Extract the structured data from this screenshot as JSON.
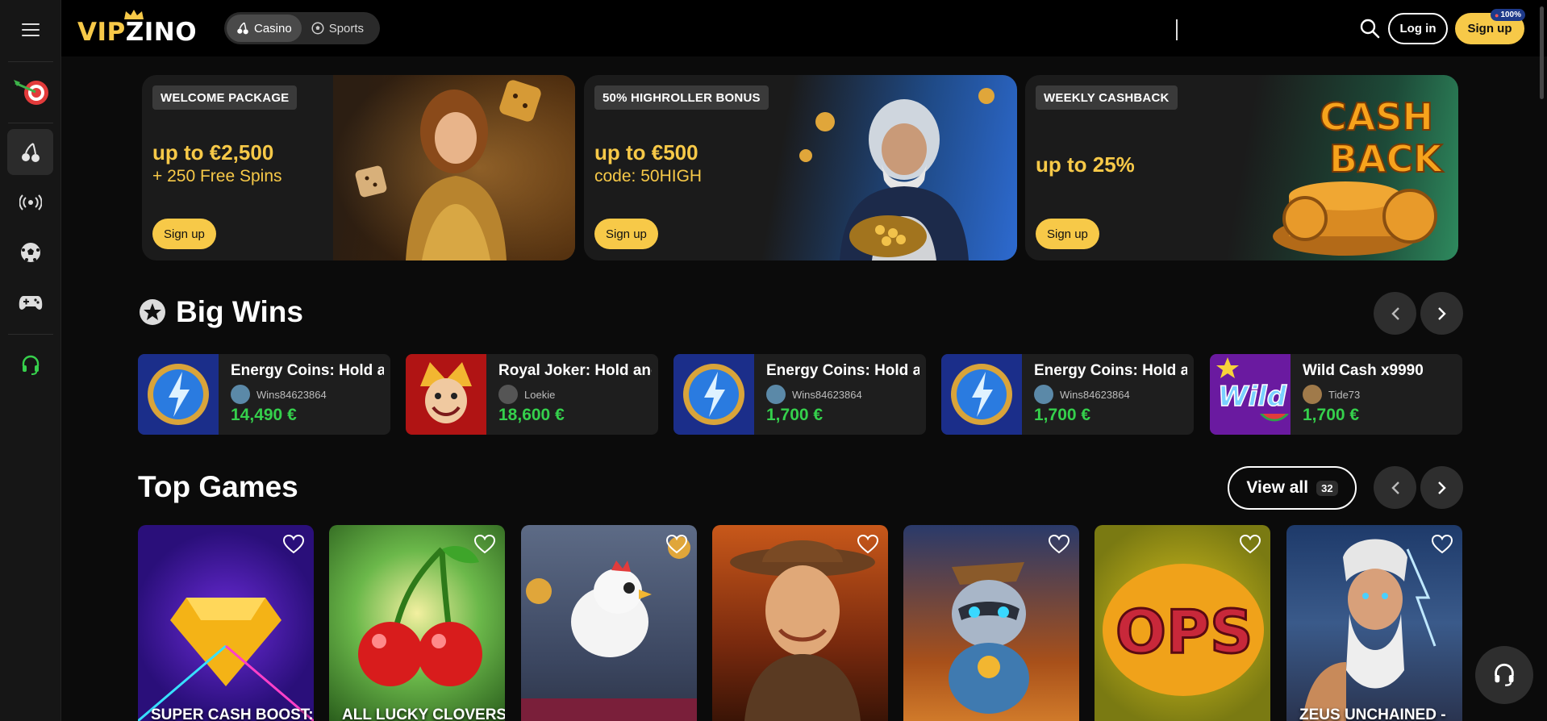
{
  "header": {
    "logo_vip": "VIP",
    "logo_zino": "ZINO",
    "modes": [
      {
        "label": "Casino",
        "active": true
      },
      {
        "label": "Sports",
        "active": false
      }
    ],
    "login_label": "Log in",
    "signup_label": "Sign up",
    "signup_badge": "100%"
  },
  "sidebar": {
    "items": [
      {
        "icon": "menu-icon"
      },
      {
        "icon": "dart-target-icon"
      },
      {
        "icon": "cherries-icon",
        "active": true
      },
      {
        "icon": "live-broadcast-icon"
      },
      {
        "icon": "soccer-ball-icon"
      },
      {
        "icon": "gamepad-icon"
      },
      {
        "icon": "headset-icon"
      }
    ]
  },
  "promos": [
    {
      "tag": "WELCOME PACKAGE",
      "amount": "up to €2,500",
      "sub": "+ 250 Free Spins",
      "cta": "Sign up"
    },
    {
      "tag": "50% HIGHROLLER BONUS",
      "amount": "up to €500",
      "sub": "code: 50HIGH",
      "cta": "Sign up"
    },
    {
      "tag": "WEEKLY CASHBACK",
      "amount": "up to 25%",
      "sub": "",
      "cta": "Sign up",
      "art_text_1": "CASH",
      "art_text_2": "BACK"
    }
  ],
  "big_wins": {
    "title": "Big Wins",
    "items": [
      {
        "game": "Energy Coins: Hold and Win",
        "user": "Wins84623864",
        "amount": "14,490 €"
      },
      {
        "game": "Royal Joker: Hold and Win",
        "user": "Loekie",
        "amount": "18,600 €"
      },
      {
        "game": "Energy Coins: Hold and Win",
        "user": "Wins84623864",
        "amount": "1,700 €"
      },
      {
        "game": "Energy Coins: Hold and Win",
        "user": "Wins84623864",
        "amount": "1,700 €"
      },
      {
        "game": "Wild Cash x9990",
        "user": "Tide73",
        "amount": "1,700 €"
      }
    ]
  },
  "top_games": {
    "title": "Top Games",
    "view_all_label": "View all",
    "view_all_count": "32",
    "games": [
      {
        "name": "SUPER CASH BOOST:"
      },
      {
        "name": "ALL LUCKY CLOVERS"
      },
      {
        "name": ""
      },
      {
        "name": ""
      },
      {
        "name": ""
      },
      {
        "name": ""
      },
      {
        "name": "ZEUS UNCHAINED -"
      }
    ]
  },
  "colors": {
    "accent": "#f7c948",
    "win_green": "#35d04c",
    "background": "#0b0b0b"
  }
}
